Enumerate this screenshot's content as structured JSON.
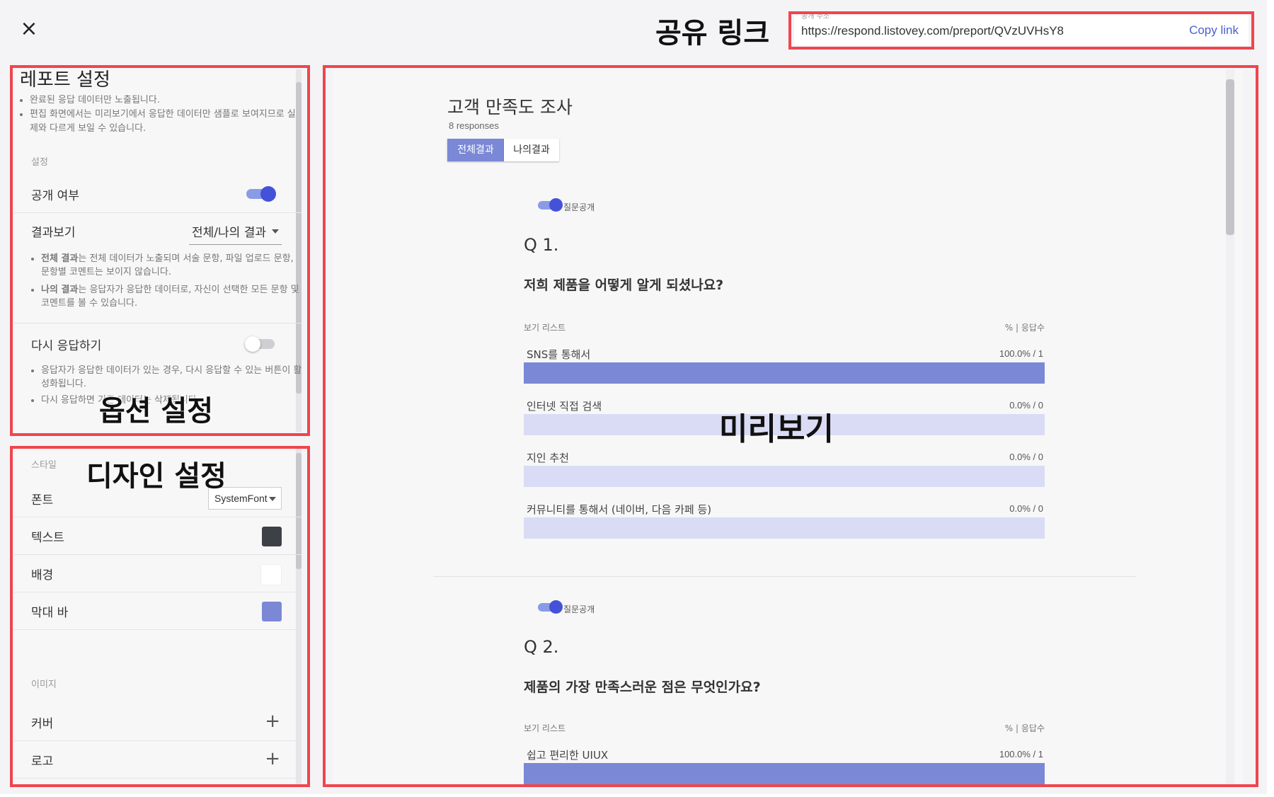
{
  "header": {
    "close_icon": "close-icon",
    "share_annotation": "공유 링크",
    "share": {
      "field_label": "공개 주소",
      "url": "https://respond.listovey.com/preport/QVzUVHsY8",
      "copy_label": "Copy link"
    }
  },
  "annotations": {
    "options": "옵션 설정",
    "design": "디자인 설정",
    "preview": "미리보기"
  },
  "options_panel": {
    "title": "레포트 설정",
    "notes": [
      "완료된 응답 데이터만 노출됩니다.",
      "편집 화면에서는 미리보기에서 응답한 데이터만 샘플로 보여지므로 실제와 다르게 보일 수 있습니다."
    ],
    "section_label": "설정",
    "public": {
      "label": "공개 여부",
      "on": true
    },
    "result_view": {
      "label": "결과보기",
      "selected": "전체/나의 결과",
      "notes": [
        {
          "bold": "전체 결과",
          "text": "는 전체 데이터가 노출되며 서술 문항, 파일 업로드 문항, 문항별 코멘트는 보이지 않습니다."
        },
        {
          "bold": "나의 결과",
          "text": "는 응답자가 응답한 데이터로, 자신이 선택한 모든 문항 및 코멘트를 볼 수 있습니다."
        }
      ]
    },
    "respond_again": {
      "label": "다시 응답하기",
      "on": false,
      "notes": [
        "응답자가 응답한 데이터가 있는 경우, 다시 응답할 수 있는 버튼이 활성화됩니다.",
        "다시 응답하면 기존 데이터는 삭제됩니다."
      ]
    }
  },
  "design_panel": {
    "style_label": "스타일",
    "font": {
      "label": "폰트",
      "value": "SystemFont"
    },
    "text": {
      "label": "텍스트",
      "color": "#3d4147"
    },
    "background": {
      "label": "배경",
      "color": "#ffffff"
    },
    "bar": {
      "label": "막대 바",
      "color": "#7b88d6"
    },
    "image_label": "이미지",
    "cover": {
      "label": "커버",
      "icon": "plus-icon"
    },
    "logo": {
      "label": "로고",
      "icon": "plus-icon"
    }
  },
  "preview": {
    "title": "고객 만족도 조사",
    "responses": "8 responses",
    "tabs": [
      "전체결과",
      "나의결과"
    ],
    "bar_color": "#7b88d6",
    "track_color": "#d9dcf4",
    "questions": [
      {
        "toggle_label": "질문공개",
        "number": "Q 1.",
        "text": "저희 제품을 어떻게 알게 되셨나요?",
        "list_label": "보기 리스트",
        "metric_label": "% | 응답수",
        "options": [
          {
            "label": "SNS를 통해서",
            "value": "100.0% / 1",
            "percent": 100
          },
          {
            "label": "인터넷 직접 검색",
            "value": "0.0% / 0",
            "percent": 0
          },
          {
            "label": "지인 추천",
            "value": "0.0% / 0",
            "percent": 0
          },
          {
            "label": "커뮤니티를 통해서 (네이버, 다음 카페 등)",
            "value": "0.0% / 0",
            "percent": 0
          }
        ]
      },
      {
        "toggle_label": "질문공개",
        "number": "Q 2.",
        "text": "제품의 가장 만족스러운 점은 무엇인가요?",
        "list_label": "보기 리스트",
        "metric_label": "% | 응답수",
        "options": [
          {
            "label": "쉽고 편리한 UIUX",
            "value": "100.0% / 1",
            "percent": 100
          }
        ]
      }
    ]
  }
}
